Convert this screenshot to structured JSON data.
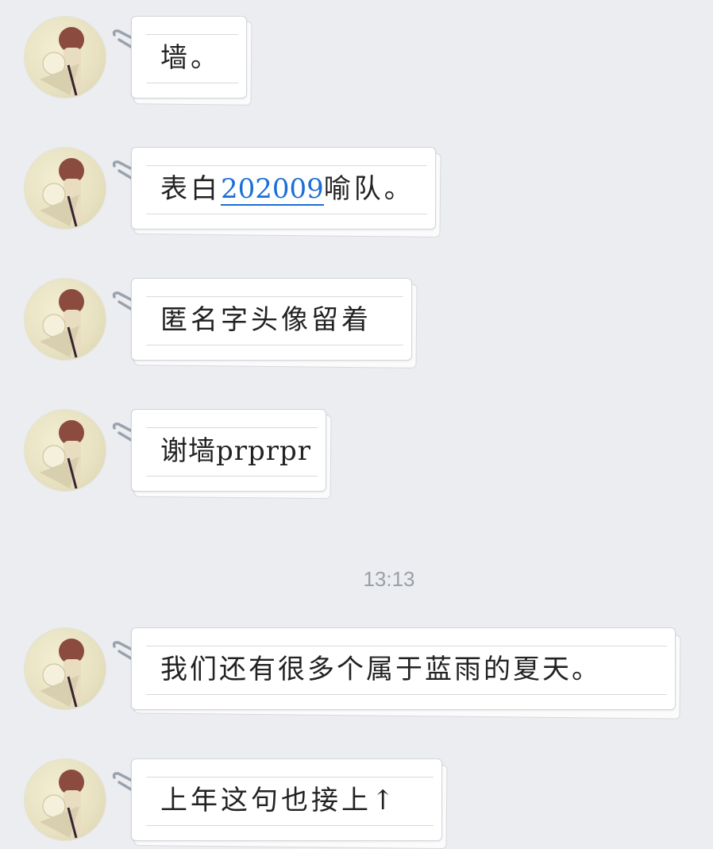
{
  "colors": {
    "background": "#ebedf1",
    "bubble": "#ffffff",
    "link": "#1a6fd6",
    "timestamp": "#9aa0a8"
  },
  "timestamp": "13:13",
  "messages": [
    {
      "text": "墙。"
    },
    {
      "text_before": "表白",
      "link": "202009",
      "text_after": "喻队。"
    },
    {
      "text": "匿名字头像留着"
    },
    {
      "text": "谢墙prprpr"
    },
    {
      "text": "我们还有很多个属于蓝雨的夏天。"
    },
    {
      "text": "上年这句也接上↑"
    }
  ],
  "icons": {
    "avatar": "avatar-anime-illustration",
    "clip": "paperclip-icon"
  }
}
